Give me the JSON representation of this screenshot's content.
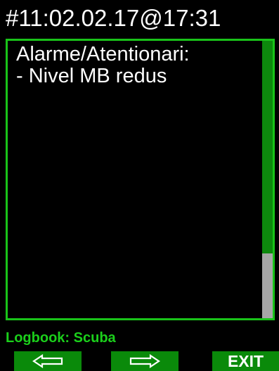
{
  "header": {
    "title": "#11:02.02.17@17:31"
  },
  "content": {
    "line1": "Alarme/Atentionari:",
    "line2": "- Nivel MB redus"
  },
  "status": {
    "text": "Logbook: Scuba"
  },
  "buttons": {
    "prev_icon": "arrow-left-icon",
    "next_icon": "arrow-right-icon",
    "exit_label": "EXIT"
  },
  "colors": {
    "accent": "#19c319",
    "button_bg": "#0a8a0a",
    "scrollbar": "#0d880d",
    "scroll_thumb": "#a6a6a6"
  }
}
